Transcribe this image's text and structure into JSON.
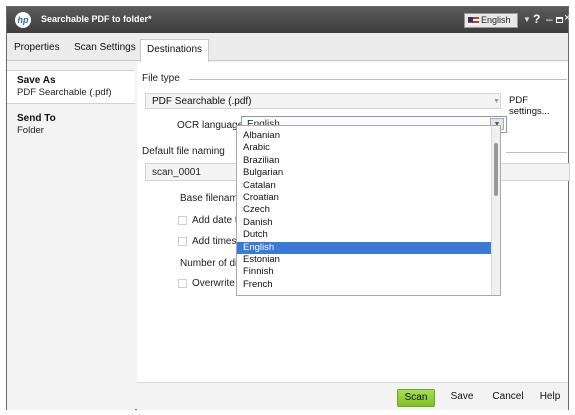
{
  "window": {
    "title": "Searchable PDF to folder*",
    "logo": "hp"
  },
  "titlebar": {
    "language": "English",
    "help": "?",
    "minimize": "–",
    "close": "×"
  },
  "tabs": [
    "Properties",
    "Scan Settings",
    "Destinations"
  ],
  "sidebar": {
    "items": [
      {
        "title": "Save As",
        "subtitle": "PDF Searchable (.pdf)"
      },
      {
        "title": "Send To",
        "subtitle": "Folder"
      }
    ]
  },
  "file_type": {
    "section_label": "File type",
    "value": "PDF Searchable (.pdf)",
    "pdf_settings_label": "PDF settings...",
    "ocr_label": "OCR language:",
    "ocr_value": "English"
  },
  "file_naming": {
    "section_label": "Default file naming",
    "filename": "scan_0001",
    "base_filename_label": "Base filename:",
    "add_date_label": "Add date to fi",
    "add_timestamp_label": "Add timestam",
    "num_digits_label": "Number of digi",
    "overwrite_label": "Overwrite exi"
  },
  "ocr_dropdown": {
    "options": [
      "Albanian",
      "Arabic",
      "Brazilian",
      "Bulgarian",
      "Catalan",
      "Croatian",
      "Czech",
      "Danish",
      "Dutch",
      "English",
      "Estonian",
      "Finnish",
      "French"
    ],
    "selected": "English"
  },
  "footer": {
    "scan": "Scan",
    "save": "Save",
    "cancel": "Cancel",
    "help": "Help"
  },
  "colors": {
    "selection": "#3a79d6",
    "scan_button": "#8fcb33",
    "titlebar": "#4a4a4a"
  }
}
